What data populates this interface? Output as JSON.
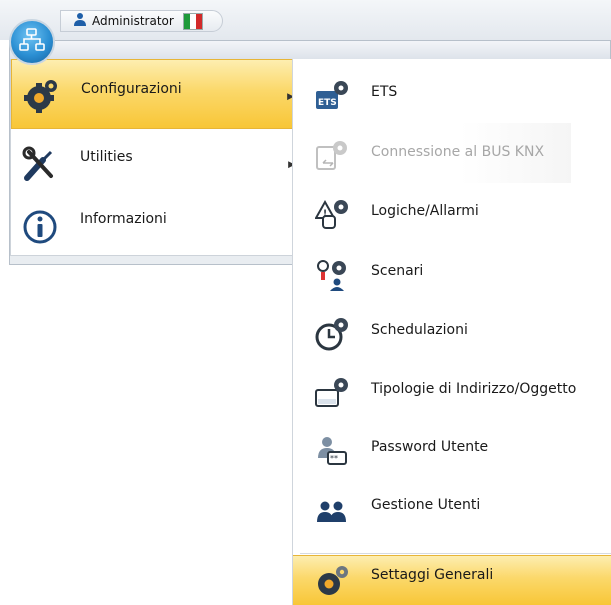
{
  "header": {
    "user_name": "Administrator",
    "language_flag_icon": "italy-flag-icon",
    "flag_colors": [
      "#1e9a3a",
      "#ffffff",
      "#d22a2a"
    ],
    "app_icon": "network-map-icon"
  },
  "left_menu": {
    "items": [
      {
        "label": "Configurazioni",
        "icon": "gear-icon",
        "has_submenu": true,
        "selected": true
      },
      {
        "label": "Utilities",
        "icon": "tools-icon",
        "has_submenu": true,
        "selected": false
      },
      {
        "label": "Informazioni",
        "icon": "info-icon",
        "has_submenu": false,
        "selected": false
      }
    ]
  },
  "submenu": {
    "items": [
      {
        "label": "ETS",
        "icon": "ets-gear-icon",
        "enabled": true
      },
      {
        "label": "Connessione al BUS KNX",
        "icon": "bus-connection-icon",
        "enabled": false
      },
      {
        "label": "Logiche/Allarmi",
        "icon": "logic-alarm-icon",
        "enabled": true
      },
      {
        "label": "Scenari",
        "icon": "scenario-icon",
        "enabled": true
      },
      {
        "label": "Schedulazioni",
        "icon": "clock-gear-icon",
        "enabled": true
      },
      {
        "label": "Tipologie di Indirizzo/Oggetto",
        "icon": "address-type-icon",
        "enabled": true
      },
      {
        "label": "Password Utente",
        "icon": "user-password-icon",
        "enabled": true
      },
      {
        "label": "Gestione Utenti",
        "icon": "users-management-icon",
        "enabled": true
      },
      {
        "label": "Settaggi Generali",
        "icon": "general-settings-icon",
        "enabled": true,
        "highlighted": true
      }
    ]
  },
  "colors": {
    "highlight": "#fbd86a",
    "accent_blue": "#2b8fd3",
    "disabled_text": "#a7a7a7"
  }
}
